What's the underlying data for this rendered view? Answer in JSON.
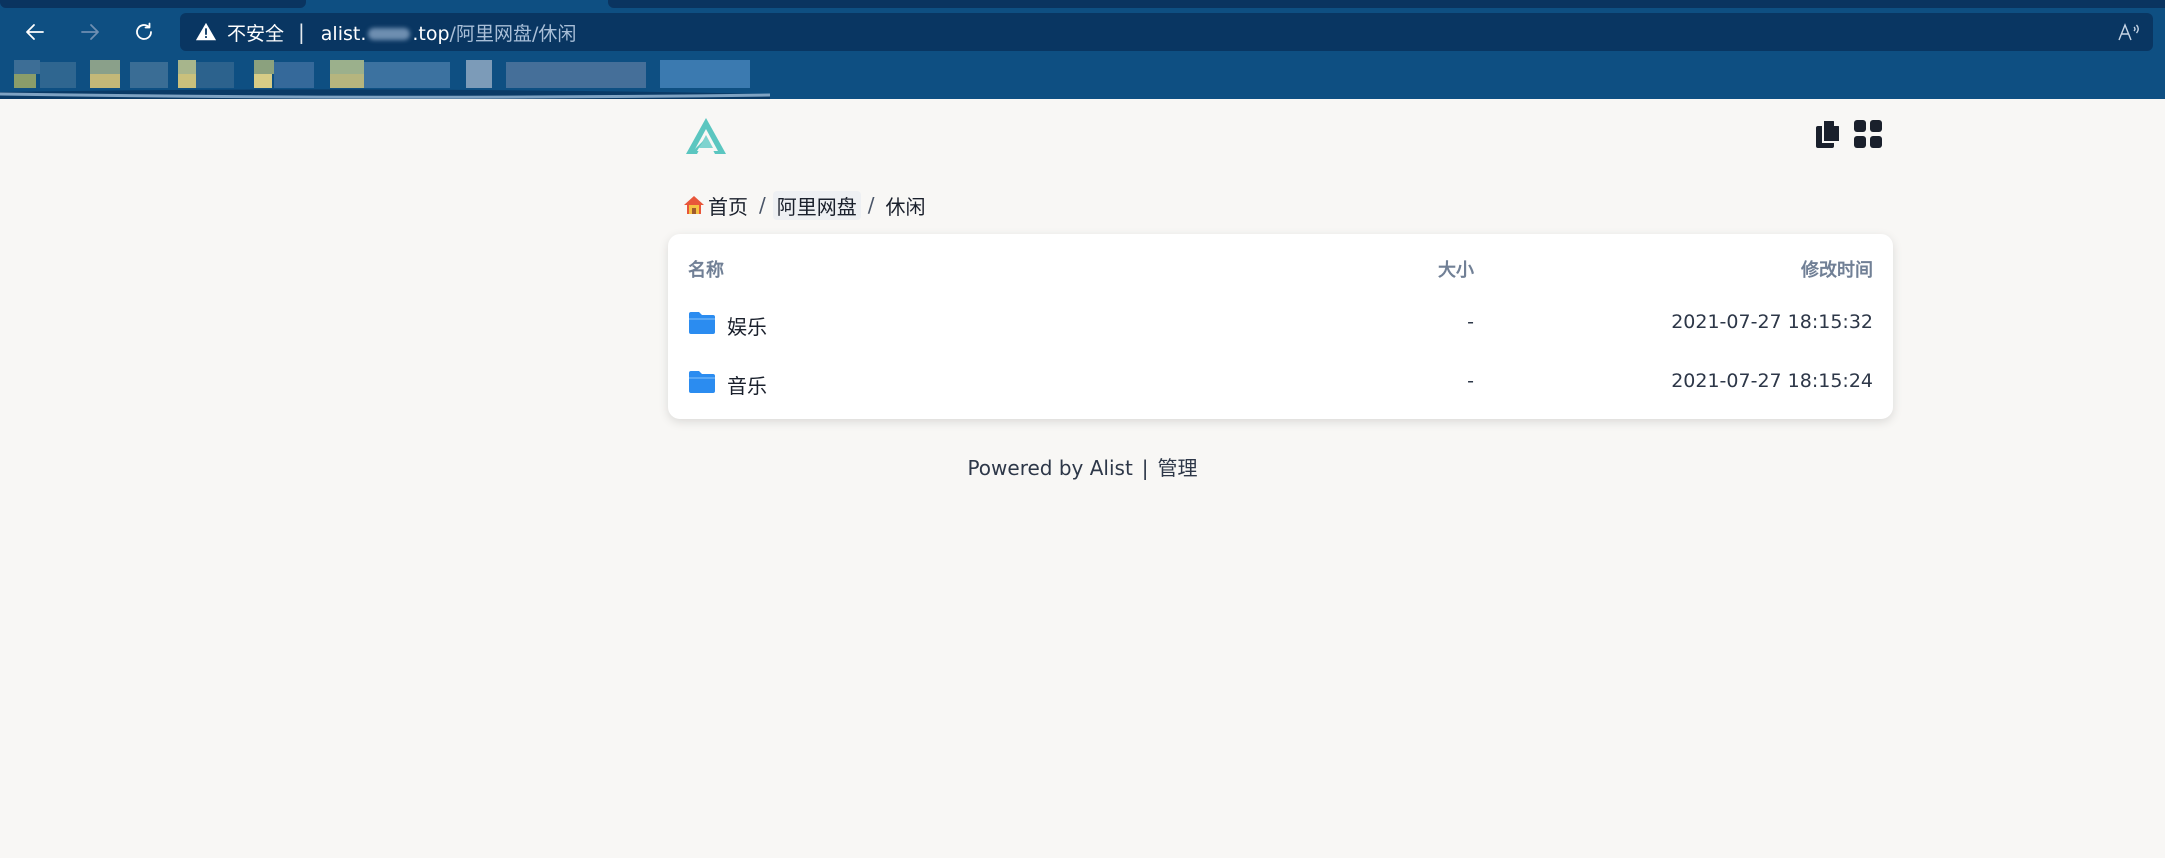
{
  "browser": {
    "security_label": "不安全",
    "url_prefix": "alist.",
    "url_domain_end": ".top",
    "url_path": "/阿里网盘/休闲"
  },
  "breadcrumb": {
    "items": [
      {
        "label": "首页",
        "icon": "home-icon"
      },
      {
        "label": "阿里网盘"
      },
      {
        "label": "休闲"
      }
    ],
    "separator": "/"
  },
  "file_list": {
    "columns": {
      "name": "名称",
      "size": "大小",
      "modified": "修改时间"
    },
    "rows": [
      {
        "name": "娱乐",
        "size": "-",
        "modified": "2021-07-27 18:15:32",
        "icon": "folder-icon"
      },
      {
        "name": "音乐",
        "size": "-",
        "modified": "2021-07-27 18:15:24",
        "icon": "folder-icon"
      }
    ]
  },
  "footer": {
    "powered_by": "Powered by Alist",
    "separator": "|",
    "admin_link": "管理"
  },
  "colors": {
    "chrome": "#0e4f82",
    "address_bar": "#093662",
    "page_bg": "#f8f7f5",
    "folder": "#2b8cf0",
    "logo": "#5bc6c0"
  }
}
